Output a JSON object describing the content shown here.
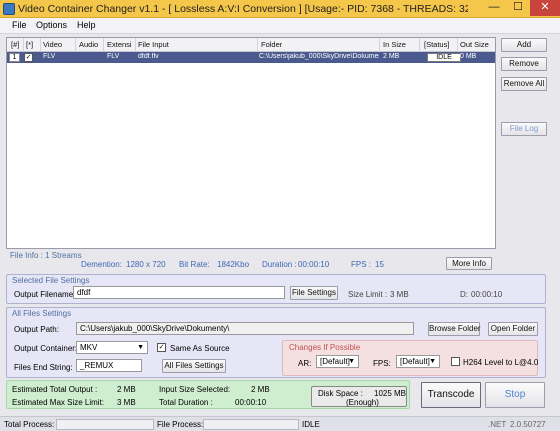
{
  "window": {
    "title": "Video Container Changer v1.1 - [ Lossless A:V:I Conversion ] [Usage:- PID: 7368 - THREADS: 32 - RAM: 52MB - ...",
    "min": "—",
    "max": "☐",
    "close": "✕"
  },
  "menu": [
    "File",
    "Options",
    "Help"
  ],
  "table": {
    "headers": [
      "[#]",
      "[*]",
      "Video",
      "Audio",
      "Extensi",
      "File Input",
      "Folder",
      "In Size",
      "[Status]",
      "Out Size"
    ],
    "row": {
      "num": "1",
      "checked": "✓",
      "video": "FLV",
      "audio": "",
      "ext": "FLV",
      "file": "dfdf.flv",
      "folder": "C:\\Users\\jakub_000\\SkyDrive\\Dokumenty\\",
      "insize": "2 MB",
      "status": "IDLE",
      "outsize": "0 MB"
    }
  },
  "side_buttons": {
    "add": "Add",
    "remove": "Remove",
    "remove_all": "Remove All",
    "file_log": "File Log"
  },
  "file_info": {
    "streams": "File Info : 1 Streams",
    "dim_label": "Demention:",
    "dim_value": "1280 x 720",
    "bitrate_label": "Bit Rate:",
    "bitrate_value": "1842Kbo",
    "duration_label": "Duration :",
    "duration_value": "00:00:10",
    "fps_label": "FPS :",
    "fps_value": "15",
    "more_info": "More Info"
  },
  "selected_file": {
    "title": "Selected File Settings",
    "output_label": "Output Filename:",
    "output_value": "dfdf",
    "settings_btn": "File Settings",
    "size_limit_label": "Size Limit :",
    "size_limit_value": "3 MB",
    "d_label": "D:",
    "d_value": "00:00:10"
  },
  "all_files": {
    "title": "All Files Settings",
    "path_label": "Output Path:",
    "path_value": "C:\\Users\\jakub_000\\SkyDrive\\Dokumenty\\",
    "browse": "Browse Folder",
    "open": "Open Folder",
    "container_label": "Output Container:",
    "container_value": "MKV",
    "same_as_source": "Same As Source",
    "same_checked": "✓",
    "end_label": "Files End String:",
    "end_value": "_REMUX",
    "settings_btn": "All Files Settings",
    "changes_title": "Changes If Possible",
    "ar_label": "AR:",
    "ar_value": "[Default]",
    "fps_label": "FPS:",
    "fps_value": "[Default]",
    "h264_label": "H264 Level to L@4.0"
  },
  "status": {
    "est_total_label": "Estimated Total Output :",
    "est_total_value": "2 MB",
    "est_max_label": "Estimated Max Size Limit:",
    "est_max_value": "3 MB",
    "input_size_label": "Input Size Selected:",
    "input_size_value": "2 MB",
    "total_dur_label": "Total Duration :",
    "total_dur_value": "00:00:10",
    "disk_label": "Disk Space :",
    "disk_value": "1025 MB",
    "disk_note": "(Enough)"
  },
  "actions": {
    "transcode": "Transcode",
    "stop": "Stop"
  },
  "footer": {
    "total_label": "Total Process:",
    "file_label": "File Process:",
    "state": "IDLE",
    "net": ".NET",
    "version": "2.0.50727"
  }
}
